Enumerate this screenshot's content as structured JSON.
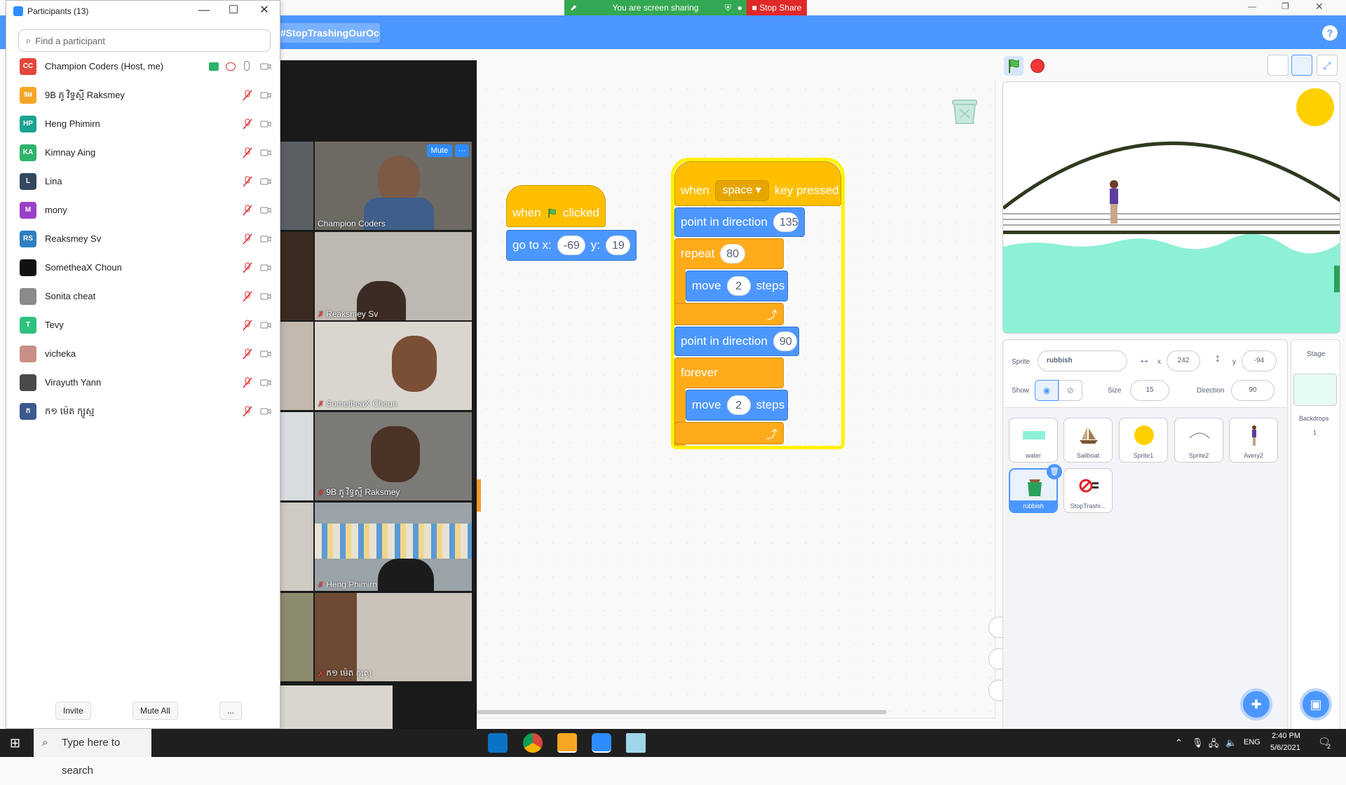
{
  "zoom": {
    "sharing_status": "You are screen sharing",
    "stop_share": "Stop Share",
    "participants_panel": {
      "title": "Participants (13)",
      "search_placeholder": "Find a participant",
      "participants": [
        {
          "initials": "CC",
          "name": "Champion Coders (Host, me)",
          "color": "#e2473b"
        },
        {
          "initials": "9អ",
          "name": "9B ភូ វិទ្ធស្មី Raksmey",
          "color": "#f5a623"
        },
        {
          "initials": "HP",
          "name": "Heng Phimirn",
          "color": "#1aa38f"
        },
        {
          "initials": "KA",
          "name": "Kimnay Aing",
          "color": "#2fb36b"
        },
        {
          "initials": "L",
          "name": "Lina",
          "color": "#34495e"
        },
        {
          "initials": "M",
          "name": "mony",
          "color": "#9b3fc7"
        },
        {
          "initials": "RS",
          "name": "Reaksmey Sv",
          "color": "#2d7fc1"
        },
        {
          "initials": "",
          "name": "SometheaX Choun",
          "color": "#111111"
        },
        {
          "initials": "",
          "name": "Sonita cheat",
          "color": "#8a8a8a"
        },
        {
          "initials": "T",
          "name": "Tevy",
          "color": "#2ec27e"
        },
        {
          "initials": "",
          "name": "vicheka",
          "color": "#c98f86"
        },
        {
          "initials": "",
          "name": "Virayuth Yann",
          "color": "#4a4a4a"
        },
        {
          "initials": "ក",
          "name": "ក១ ម៉េត ក្សូស្ម",
          "color": "#3a5a8c"
        }
      ],
      "invite": "Invite",
      "mute_all": "Mute All",
      "more": "..."
    },
    "video_tiles": [
      {
        "name": "Champion Coders",
        "bg": "#6d6a64",
        "mute_label": "Mute",
        "more": "···"
      },
      {
        "name": "Reaksmey Sv",
        "bg": "#bdb8b2"
      },
      {
        "name": "SometheaX Choun",
        "bg": "#d9d5cf"
      },
      {
        "name": "9B ភូ វិទ្ធស្មី Raksmey",
        "bg": "#7c7a76"
      },
      {
        "name": "Heng Phimirn",
        "bg": "#9aa3a8"
      },
      {
        "name": "ក១ ម៉េត ក្សូស្ម",
        "bg": "#c9c3ba"
      }
    ]
  },
  "scratch": {
    "project_title": "#StopTrashingOurOceans(...",
    "help": "?",
    "script1": {
      "when": "when",
      "clicked": "clicked",
      "goto": "go to x:",
      "x": "-69",
      "y_label": "y:",
      "y": "19"
    },
    "script2": {
      "when": "when",
      "key": "space",
      "key_pressed": "key pressed",
      "point_dir": "point in direction",
      "dir1": "135",
      "repeat": "repeat",
      "repeat_n": "80",
      "move": "move",
      "steps_n": "2",
      "steps": "steps",
      "point_dir2": "point in direction",
      "dir2": "90",
      "forever": "forever",
      "move2": "move",
      "steps_n2": "2",
      "steps2": "steps"
    },
    "sprite_info": {
      "sprite_label": "Sprite",
      "sprite_name": "rubbish",
      "x_label": "x",
      "x": "242",
      "y_label": "y",
      "y": "-94",
      "show_label": "Show",
      "size_label": "Size",
      "size": "15",
      "direction_label": "Direction",
      "direction": "90"
    },
    "sprites": [
      {
        "name": "water"
      },
      {
        "name": "Sailboat"
      },
      {
        "name": "Sprite1"
      },
      {
        "name": "Sprite2"
      },
      {
        "name": "Avery2"
      },
      {
        "name": "rubbish",
        "selected": true
      },
      {
        "name": "StopTrashi..."
      }
    ],
    "stage_pane": {
      "stage_label": "Stage",
      "backdrops_label": "Backdrops",
      "backdrops_count": "1"
    }
  },
  "taskbar": {
    "search_placeholder": "Type here to search",
    "lang": "ENG",
    "time": "2:40 PM",
    "date": "5/6/2021",
    "notifications": "2"
  },
  "colors": {
    "scratch_blue": "#4c97ff",
    "events_yellow": "#ffbf00",
    "control_orange": "#ffab19",
    "zoom_green": "#33a852",
    "zoom_red": "#e02828"
  }
}
